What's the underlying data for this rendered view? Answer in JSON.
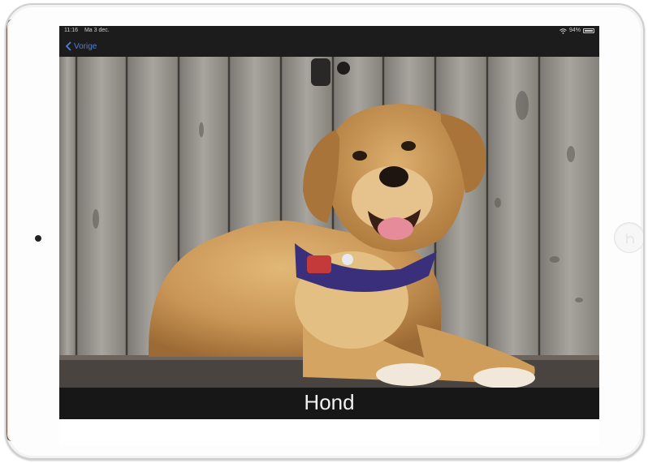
{
  "status_bar": {
    "time": "11:16",
    "date": "Ma 3 dec.",
    "battery": "94%"
  },
  "nav": {
    "back_label": "Vorige"
  },
  "photo": {
    "subject_icon": "dog-photo"
  },
  "caption": {
    "text": "Hond"
  },
  "colors": {
    "accent": "#4f7fd8",
    "screen_bg": "#111111",
    "caption_text": "#f2f2f2"
  }
}
